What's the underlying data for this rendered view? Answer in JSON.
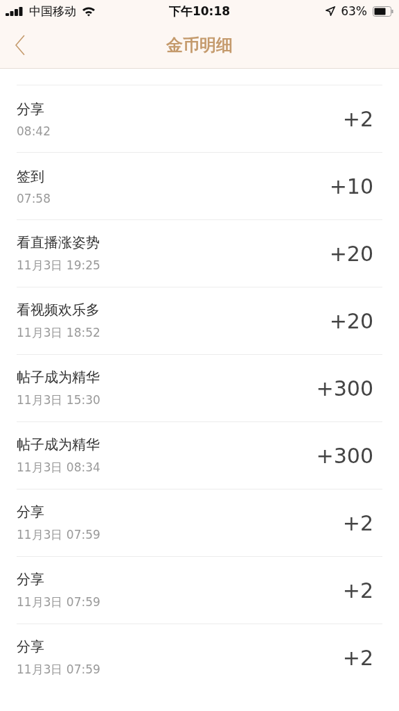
{
  "status_bar": {
    "carrier": "中国移动",
    "time": "下午10:18",
    "battery": "63%"
  },
  "nav": {
    "title": "金币明细"
  },
  "records": [
    {
      "title": "分享",
      "time": "08:42",
      "amount": "+2"
    },
    {
      "title": "签到",
      "time": "07:58",
      "amount": "+10"
    },
    {
      "title": "看直播涨姿势",
      "time": "11月3日 19:25",
      "amount": "+20"
    },
    {
      "title": "看视频欢乐多",
      "time": "11月3日 18:52",
      "amount": "+20"
    },
    {
      "title": "帖子成为精华",
      "time": "11月3日 15:30",
      "amount": "+300"
    },
    {
      "title": "帖子成为精华",
      "time": "11月3日 08:34",
      "amount": "+300"
    },
    {
      "title": "分享",
      "time": "11月3日 07:59",
      "amount": "+2"
    },
    {
      "title": "分享",
      "time": "11月3日 07:59",
      "amount": "+2"
    },
    {
      "title": "分享",
      "time": "11月3日 07:59",
      "amount": "+2"
    }
  ]
}
